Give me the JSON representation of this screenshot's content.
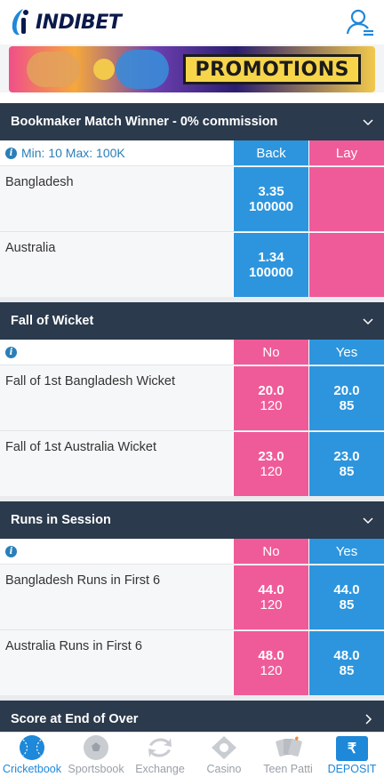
{
  "header": {
    "brand": "INDIBET"
  },
  "banner": {
    "label": "PROMOTIONS"
  },
  "bookmaker": {
    "title": "Bookmaker Match Winner - 0% commission",
    "limits": "Min: 10 Max: 100K",
    "back_label": "Back",
    "lay_label": "Lay",
    "rows": [
      {
        "name": "Bangladesh",
        "back_odds": "3.35",
        "back_volume": "100000"
      },
      {
        "name": "Australia",
        "back_odds": "1.34",
        "back_volume": "100000"
      }
    ]
  },
  "fall_of_wicket": {
    "title": "Fall of Wicket",
    "no_label": "No",
    "yes_label": "Yes",
    "rows": [
      {
        "name": "Fall of 1st Bangladesh Wicket",
        "no_odds": "20.0",
        "no_volume": "120",
        "yes_odds": "20.0",
        "yes_volume": "85"
      },
      {
        "name": "Fall of 1st Australia Wicket",
        "no_odds": "23.0",
        "no_volume": "120",
        "yes_odds": "23.0",
        "yes_volume": "85"
      }
    ]
  },
  "runs_in_session": {
    "title": "Runs in Session",
    "no_label": "No",
    "yes_label": "Yes",
    "rows": [
      {
        "name": "Bangladesh Runs in First 6",
        "no_odds": "44.0",
        "no_volume": "120",
        "yes_odds": "44.0",
        "yes_volume": "85"
      },
      {
        "name": "Australia Runs in First 6",
        "no_odds": "48.0",
        "no_volume": "120",
        "yes_odds": "48.0",
        "yes_volume": "85"
      }
    ]
  },
  "score_end_over": {
    "title": "Score at End of Over"
  },
  "footer": {
    "items": [
      {
        "label": "Cricketbook",
        "icon": "cricket-ball-icon"
      },
      {
        "label": "Sportsbook",
        "icon": "soccer-ball-icon"
      },
      {
        "label": "Exchange",
        "icon": "exchange-icon"
      },
      {
        "label": "Casino",
        "icon": "casino-icon"
      },
      {
        "label": "Teen Patti",
        "icon": "cards-icon"
      },
      {
        "label": "DEPOSIT",
        "icon": "rupee-icon"
      }
    ],
    "deposit_symbol": "₹"
  },
  "colors": {
    "back": "#2d95dd",
    "lay": "#ef5b98",
    "section_header": "#2b3a4c",
    "accent": "#1e88d9"
  }
}
